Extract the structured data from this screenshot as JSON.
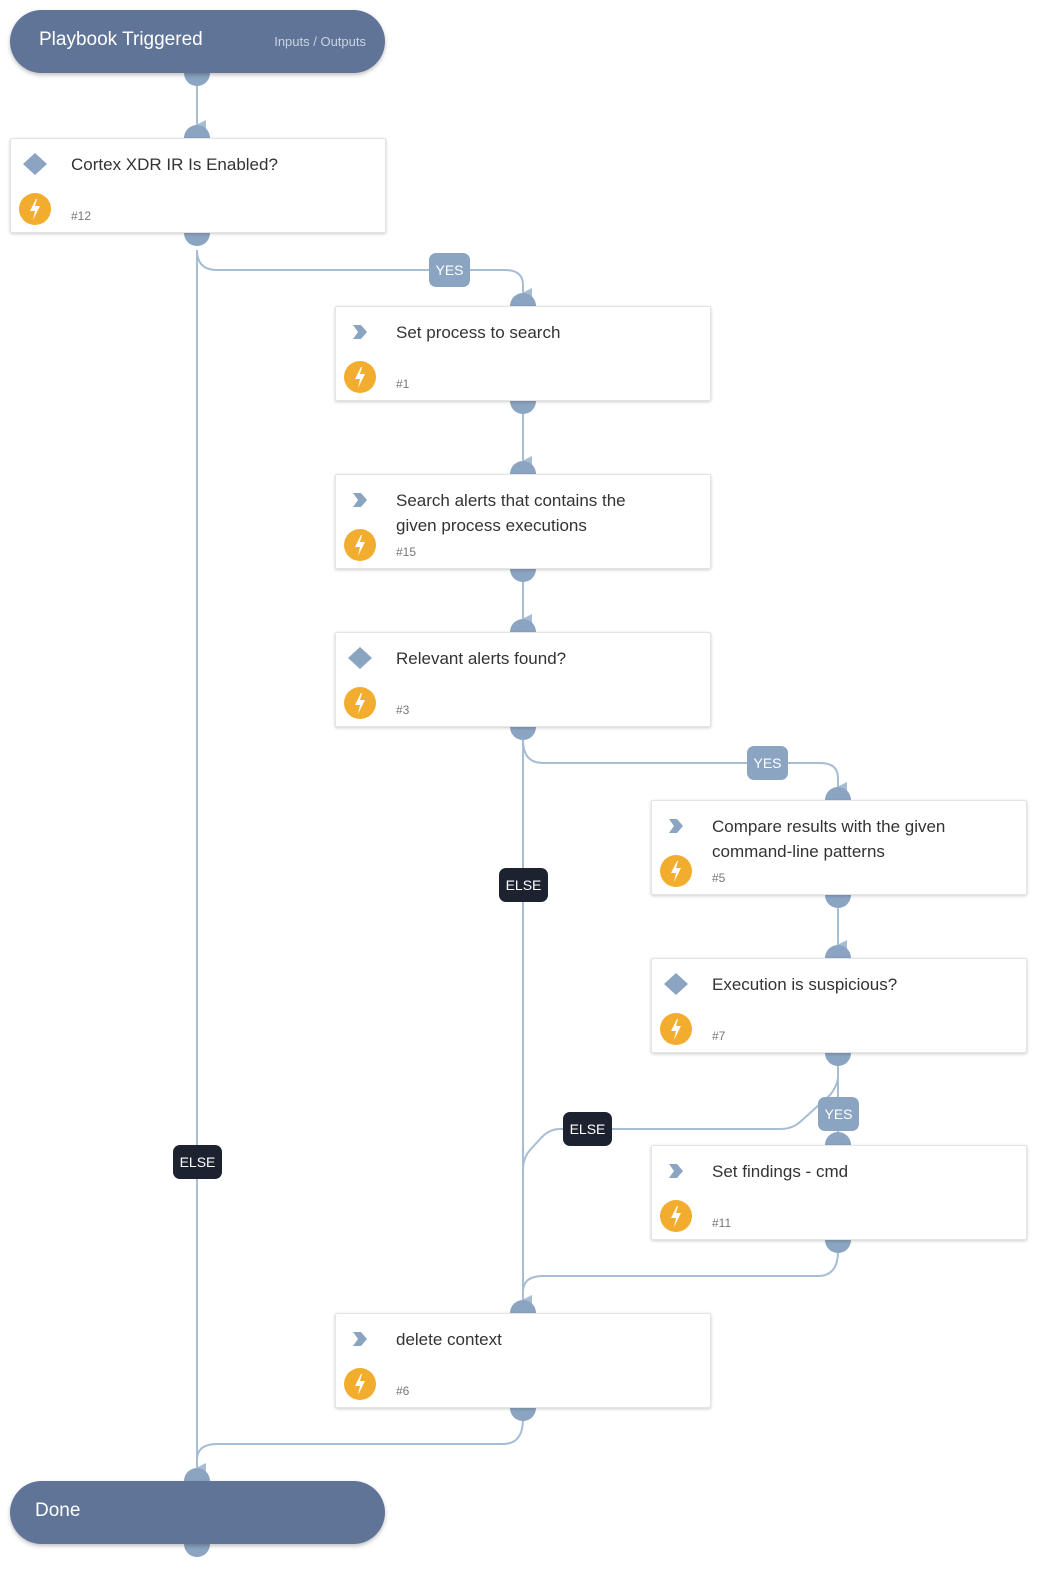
{
  "colors": {
    "pill": "#5f7497",
    "connector": "#8aa4c2",
    "edge": "#a7bdd4",
    "yes_label": "#8aa4c2",
    "else_label": "#1c2230",
    "bolt": "#f2ad2f"
  },
  "start": {
    "title": "Playbook Triggered",
    "link": "Inputs / Outputs"
  },
  "end": {
    "title": "Done"
  },
  "tasks": {
    "t12": {
      "title": "Cortex XDR IR Is Enabled?",
      "id": "#12",
      "type": "condition"
    },
    "t1": {
      "title": "Set process to search",
      "id": "#1",
      "type": "action"
    },
    "t15": {
      "title": "Search alerts that contains the given process executions",
      "id": "#15",
      "type": "action"
    },
    "t3": {
      "title": "Relevant alerts found?",
      "id": "#3",
      "type": "condition"
    },
    "t5": {
      "title": "Compare results with the given command-line patterns",
      "id": "#5",
      "type": "action"
    },
    "t7": {
      "title": "Execution is suspicious?",
      "id": "#7",
      "type": "condition"
    },
    "t11": {
      "title": "Set findings - cmd",
      "id": "#11",
      "type": "action"
    },
    "t6": {
      "title": "delete context",
      "id": "#6",
      "type": "action"
    }
  },
  "edge_labels": {
    "t12_yes": "YES",
    "t12_else": "ELSE",
    "t3_yes": "YES",
    "t3_else": "ELSE",
    "t7_yes": "YES",
    "t7_else": "ELSE"
  }
}
